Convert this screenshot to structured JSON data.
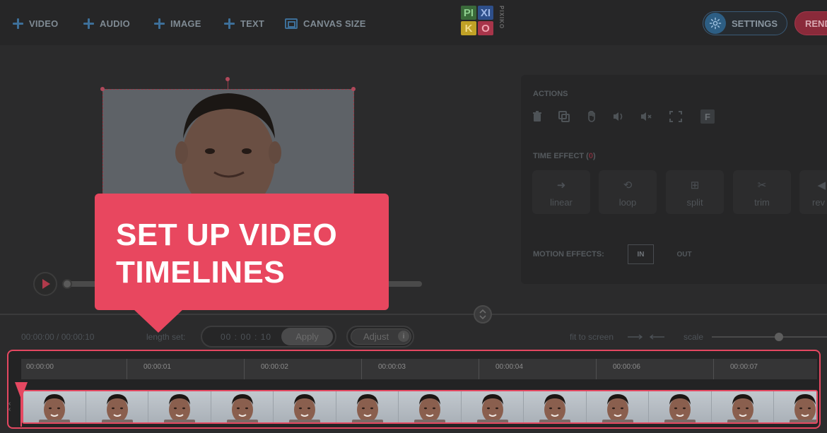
{
  "toolbar": {
    "items": [
      {
        "label": "VIDEO",
        "icon": "plus-icon"
      },
      {
        "label": "AUDIO",
        "icon": "plus-icon"
      },
      {
        "label": "IMAGE",
        "icon": "plus-icon"
      },
      {
        "label": "TEXT",
        "icon": "plus-icon"
      },
      {
        "label": "CANVAS SIZE",
        "icon": "canvas-icon"
      }
    ],
    "settings_label": "SETTINGS",
    "render_label": "REND"
  },
  "logo": {
    "letters": [
      "PI",
      "XI",
      "K",
      "O"
    ],
    "vertical": "PIXIKO",
    "colors": [
      "#3a6a3a",
      "#2e4f8a",
      "#c0a126",
      "#a8354a"
    ]
  },
  "panel": {
    "actions_label": "ACTIONS",
    "action_icons": [
      "trash-icon",
      "duplicate-icon",
      "hand-icon",
      "volume-up-icon",
      "volume-mute-icon",
      "fullscreen-icon",
      "f-icon"
    ],
    "f_label": "F",
    "time_effect_label": "TIME EFFECT (",
    "time_effect_count": "0",
    "time_effect_close": ")",
    "time_effects": [
      {
        "label": "linear",
        "icon": "arrow-right-icon",
        "glyph": "➜"
      },
      {
        "label": "loop",
        "icon": "loop-icon",
        "glyph": "⟲"
      },
      {
        "label": "split",
        "icon": "split-icon",
        "glyph": "⊞"
      },
      {
        "label": "trim",
        "icon": "scissors-icon",
        "glyph": "✂"
      },
      {
        "label": "rev",
        "icon": "reverse-icon",
        "glyph": "◀"
      }
    ],
    "motion_effects_label": "MOTION EFFECTS:",
    "in_label": "IN",
    "out_label": "OUT"
  },
  "controls": {
    "time": "00:00:00 / 00:00:10",
    "length_label": "length set:",
    "length_value": "00 : 00 : 10",
    "apply_label": "Apply",
    "adjust_label": "Adjust",
    "info_glyph": "i",
    "fit_label": "fit to screen",
    "scale_label": "scale"
  },
  "timeline": {
    "ticks": [
      "00:00:00",
      "00:00:01",
      "00:00:02",
      "00:00:03",
      "00:00:04",
      "00:00:06",
      "00:00:07"
    ],
    "thumbnail_count": 13
  },
  "callout": {
    "line1": "SET UP VIDEO",
    "line2": "TIMELINES"
  },
  "colors": {
    "accent": "#e54861",
    "blue": "#3d6f99"
  }
}
